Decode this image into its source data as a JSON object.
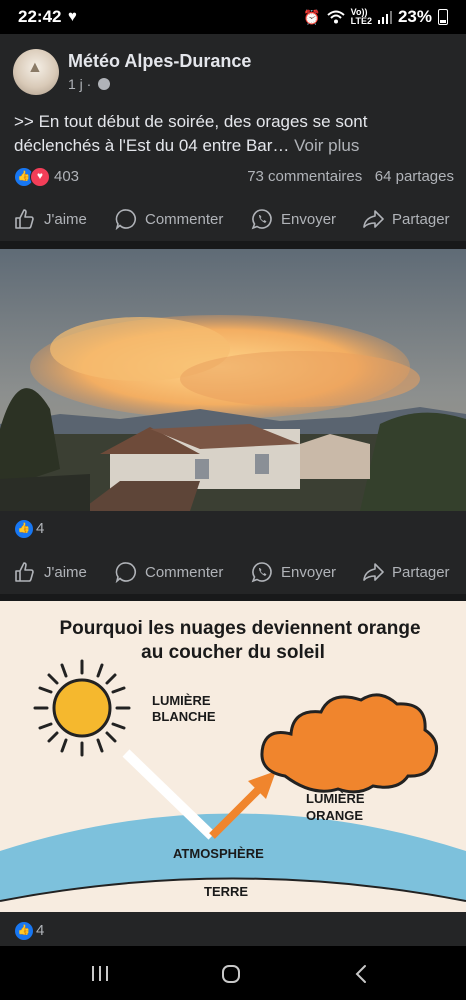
{
  "status_bar": {
    "time": "22:42",
    "lte_top": "Vo))",
    "lte_bottom": "LTE2",
    "battery": "23%"
  },
  "post": {
    "page_name": "Météo Alpes-Durance",
    "time_ago": "1 j ·",
    "text": ">> En tout début de soirée, des orages se sont déclenchés à l'Est du 04 entre Bar…",
    "see_more": "Voir plus",
    "reaction_count": "403",
    "comments": "73 commentaires",
    "shares": "64 partages"
  },
  "actions": {
    "like": "J'aime",
    "comment": "Commenter",
    "send": "Envoyer",
    "share": "Partager"
  },
  "photo1": {
    "reaction_count": "4"
  },
  "infographic": {
    "title_line1": "Pourquoi les nuages deviennent orange",
    "title_line2": "au coucher du soleil",
    "white_light_1": "LUMIÈRE",
    "white_light_2": "BLANCHE",
    "orange_light_1": "LUMIÈRE",
    "orange_light_2": "ORANGE",
    "atmosphere": "ATMOSPHÈRE",
    "earth": "TERRE",
    "reaction_count": "4"
  },
  "colors": {
    "facebook_blue": "#1877f2",
    "love_red": "#f33e58",
    "sun_yellow": "#f5b82e",
    "cloud_orange": "#f0852d",
    "sky_blue": "#7dc1dc"
  }
}
